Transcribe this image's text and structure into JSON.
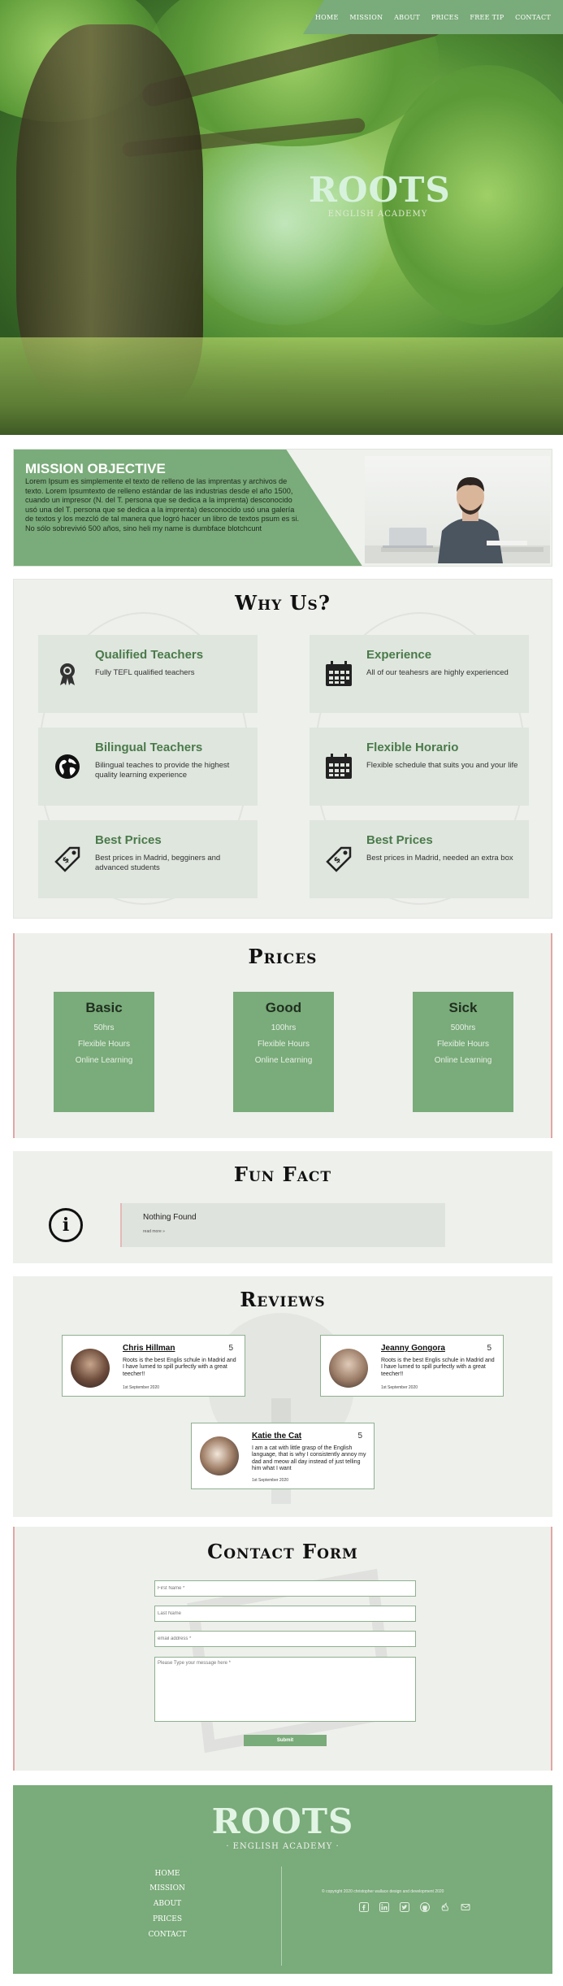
{
  "nav": {
    "items": [
      "HOME",
      "MISSION",
      "ABOUT",
      "PRICES",
      "FREE TIP",
      "CONTACT"
    ]
  },
  "hero": {
    "logo": "ROOTS",
    "subtitle": "ENGLISH ACADEMY"
  },
  "mission": {
    "title": "MISSION OBJECTIVE",
    "text": "Lorem Ipsum es simplemente el texto de relleno de las imprentas y archivos de texto. Lorem Ipsumtexto de relleno estándar de las industrias desde el año 1500, cuando un impresor (N. del T. persona que se dedica a la imprenta) desconocido usó una del T. persona que se dedica a la imprenta) desconocido usó una galería de textos y los mezcló de tal manera que logró hacer un libro de textos psum es si. No sólo sobrevivió 500 años, sino heli my name is dumbface blotchcunt"
  },
  "why_us": {
    "title": "Why Us?",
    "cards": [
      {
        "title": "Qualified Teachers",
        "desc": "Fully TEFL qualified teachers",
        "icon": "award-icon"
      },
      {
        "title": "Experience",
        "desc": "All of our teahesrs are highly experienced",
        "icon": "calendar-icon"
      },
      {
        "title": "Bilingual Teachers",
        "desc": "Bilingual teaches to provide the highest quality learning experience",
        "icon": "globe-icon"
      },
      {
        "title": "Flexible Horario",
        "desc": "Flexible schedule that suits you and your life",
        "icon": "calendar-icon"
      },
      {
        "title": "Best Prices",
        "desc": "Best prices in Madrid, begginers and advanced students",
        "icon": "price-tag-icon"
      },
      {
        "title": "Best Prices",
        "desc": "Best prices in Madrid, needed an extra box",
        "icon": "price-tag-icon"
      }
    ]
  },
  "prices": {
    "title": "Prices",
    "plans": [
      {
        "name": "Basic",
        "hours": "50hrs",
        "feature1": "Flexible Hours",
        "feature2": "Online Learning"
      },
      {
        "name": "Good",
        "hours": "100hrs",
        "feature1": "Flexible Hours",
        "feature2": "Online Learning"
      },
      {
        "name": "Sick",
        "hours": "500hrs",
        "feature1": "Flexible Hours",
        "feature2": "Online Learning"
      }
    ]
  },
  "fun_fact": {
    "title": "Fun Fact",
    "text": "Nothing Found",
    "read_more": "read more »"
  },
  "reviews": {
    "title": "Reviews",
    "items": [
      {
        "name": "Chris Hillman",
        "score": "5",
        "text": "Roots is the best Englis schule in Madrid and I have lurned to spill purfectly with a great teecher!!",
        "date": "1st September 2020"
      },
      {
        "name": "Jeanny Gongora",
        "score": "5",
        "text": "Roots is the best Englis schule in Madrid and I have lurned to spill purfectly with a great teecher!!",
        "date": "1st September 2020"
      },
      {
        "name": "Katie the Cat",
        "score": "5",
        "text": "I am a cat with little grasp of the English language, that is why I consistently annoy my dad and meow all day instead of just telling him what I want",
        "date": "1st September 2020"
      }
    ]
  },
  "contact": {
    "title": "Contact Form",
    "first_name_placeholder": "First Name *",
    "last_name_placeholder": "Last Name",
    "email_placeholder": "email address *",
    "message_placeholder": "Please Type your message here *",
    "submit_label": "Submit"
  },
  "footer": {
    "logo": "ROOTS",
    "subtitle": "· ENGLISH ACADEMY ·",
    "links": [
      "HOME",
      "MISSION",
      "ABOUT",
      "PRICES",
      "CONTACT"
    ],
    "copyright": "© copyright 2020 christopher wallace design and development 2020",
    "social_icons": [
      "facebook-icon",
      "linkedin-icon",
      "twitter-icon",
      "github-icon",
      "freecodecamp-icon",
      "email-icon"
    ]
  },
  "colors": {
    "accent_green": "#7aab7a",
    "section_bg": "#eef0ec",
    "border_pink": "#e1a7a4"
  }
}
